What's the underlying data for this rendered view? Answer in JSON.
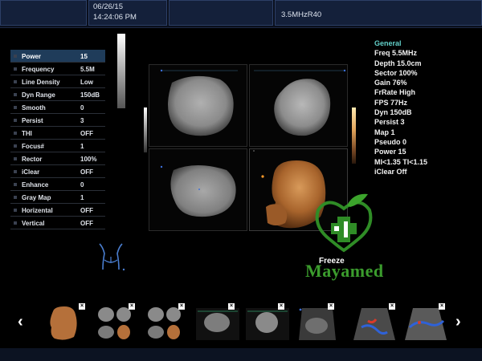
{
  "header": {
    "date": "06/26/15",
    "time": "14:24:06 PM",
    "probe": "3.5MHzR40"
  },
  "params": [
    {
      "name": "Power",
      "value": "15",
      "active": true
    },
    {
      "name": "Frequency",
      "value": "5.5M"
    },
    {
      "name": "Line Density",
      "value": "Low"
    },
    {
      "name": "Dyn Range",
      "value": "150dB"
    },
    {
      "name": "Smooth",
      "value": "0"
    },
    {
      "name": "Persist",
      "value": "3"
    },
    {
      "name": "THI",
      "value": "OFF"
    },
    {
      "name": "Focus#",
      "value": "1"
    },
    {
      "name": "Rector",
      "value": "100%"
    },
    {
      "name": "iClear",
      "value": "OFF"
    },
    {
      "name": "Enhance",
      "value": "0"
    },
    {
      "name": "Gray Map",
      "value": "1"
    },
    {
      "name": "Horizental",
      "value": "OFF"
    },
    {
      "name": "Vertical",
      "value": "OFF"
    }
  ],
  "info": {
    "header": "General",
    "lines": [
      "Freq 5.5MHz",
      "Depth 15.0cm",
      "Sector 100%",
      "Gain 76%",
      "FrRate High",
      "FPS 77Hz",
      "Dyn 150dB",
      "Persist 3",
      "Map 1",
      "Pseudo 0",
      "Power 15",
      "MI<1.35  TI<1.15",
      "iClear Off"
    ]
  },
  "status": {
    "freeze_label": "Freeze",
    "brand": "Mayamed"
  },
  "thumbnails": {
    "prev_arrow": "‹",
    "next_arrow": "›",
    "close_glyph": "×",
    "items": [
      {
        "kind": "3d-fetus",
        "icon": "thumb-3d-fetus"
      },
      {
        "kind": "quad-gray",
        "icon": "thumb-quad"
      },
      {
        "kind": "quad-mixed",
        "icon": "thumb-quad-mixed"
      },
      {
        "kind": "quad-gray-2",
        "icon": "thumb-quad-2"
      },
      {
        "kind": "quad-gray-3",
        "icon": "thumb-quad-3"
      },
      {
        "kind": "single-gray",
        "icon": "thumb-single-gray"
      },
      {
        "kind": "color-doppler",
        "icon": "thumb-color-doppler"
      },
      {
        "kind": "color-doppler-2",
        "icon": "thumb-color-doppler-2"
      }
    ]
  },
  "colors": {
    "active_param": "#1f3c5a",
    "info_header": "#62d0c9",
    "brand_green": "#3b9c2d",
    "topbar_cell": "#14203a"
  }
}
